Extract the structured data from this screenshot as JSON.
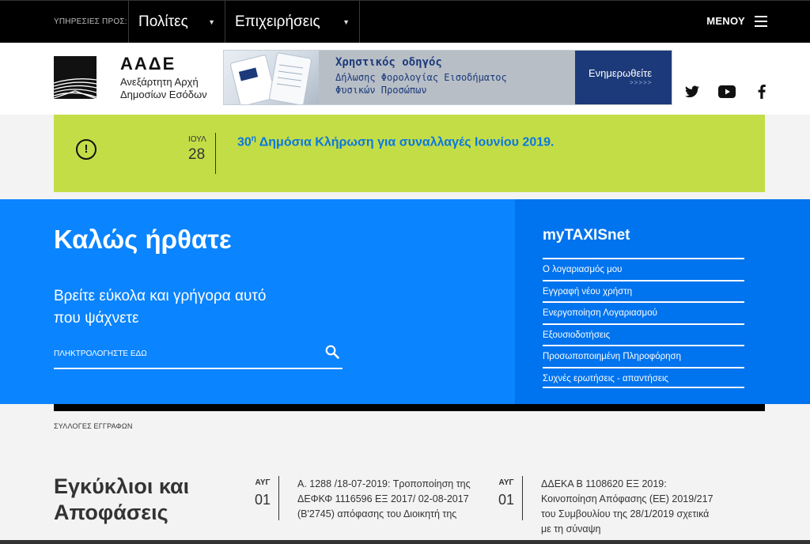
{
  "topnav": {
    "services_label": "ΥΠΗΡΕΣΙΕΣ ΠΡΟΣ:",
    "tabs": [
      {
        "label": "Πολίτες"
      },
      {
        "label": "Επιχειρήσεις"
      }
    ],
    "menu_label": "ΜΕΝΟΥ"
  },
  "header": {
    "logo_name": "ΑΑΔΕ",
    "logo_sub": "Ανεξάρτητη Αρχή Δημοσίων Εσόδων",
    "banner": {
      "title": "Χρηστικός οδηγός",
      "line1": "Δήλωσης Φορολογίας Εισοδήματος",
      "line2": "Φυσικών Προσώπων",
      "button": "Ενημερωθείτε",
      "arrows": ">>>>>"
    },
    "social": [
      "twitter-icon",
      "youtube-icon",
      "facebook-icon"
    ]
  },
  "announcement": {
    "month": "ΙΟΥΛ",
    "day": "28",
    "sup": "η",
    "number": "30",
    "text": " Δημόσια Κλήρωση για συναλλαγές Ιουνίου 2019.",
    "accent": "#c3dd47",
    "link_color": "#0b78e0"
  },
  "hero": {
    "welcome": "Καλώς ήρθατε",
    "find": "Βρείτε εύκολα και γρήγορα αυτό που ψάχνετε",
    "search_placeholder": "ΠΛΗΚΤΡΟΛΟΓΗΣΤΕ ΕΔΩ",
    "bg": "#0a84ff"
  },
  "mytaxisnet": {
    "title": "myTAXISnet",
    "items": [
      {
        "label": "Ο λογαριασμός μου"
      },
      {
        "label": "Εγγραφή νέου χρήστη"
      },
      {
        "label": "Ενεργοποίηση Λογαριασμού"
      },
      {
        "label": "Εξουσιοδοτήσεις"
      },
      {
        "label": "Προσωποποιημένη Πληροφόρηση"
      },
      {
        "label": "Συχνές ερωτήσεις - απαντήσεις"
      }
    ]
  },
  "collections": {
    "label": "ΣΥΛΛΟΓΕΣ ΕΓΓΡΑΦΩΝ",
    "section_title": "Εγκύκλιοι και Αποφάσεις",
    "news": [
      {
        "month": "ΑΥΓ",
        "day": "01",
        "text": "Α. 1288 /18-07-2019: Τροποποίηση της ΔΕΦΚΦ 1116596 ΕΞ 2017/ 02-08-2017 (Β'2745) απόφασης του Διοικητή της"
      },
      {
        "month": "ΑΥΓ",
        "day": "01",
        "text": "ΔΔΕΚΑ Β 1108620 ΕΞ 2019: Κοινοποίηση Απόφασης (ΕΕ) 2019/217 του Συμβουλίου της 28/1/2019 σχετικά με τη σύναψη"
      }
    ]
  }
}
